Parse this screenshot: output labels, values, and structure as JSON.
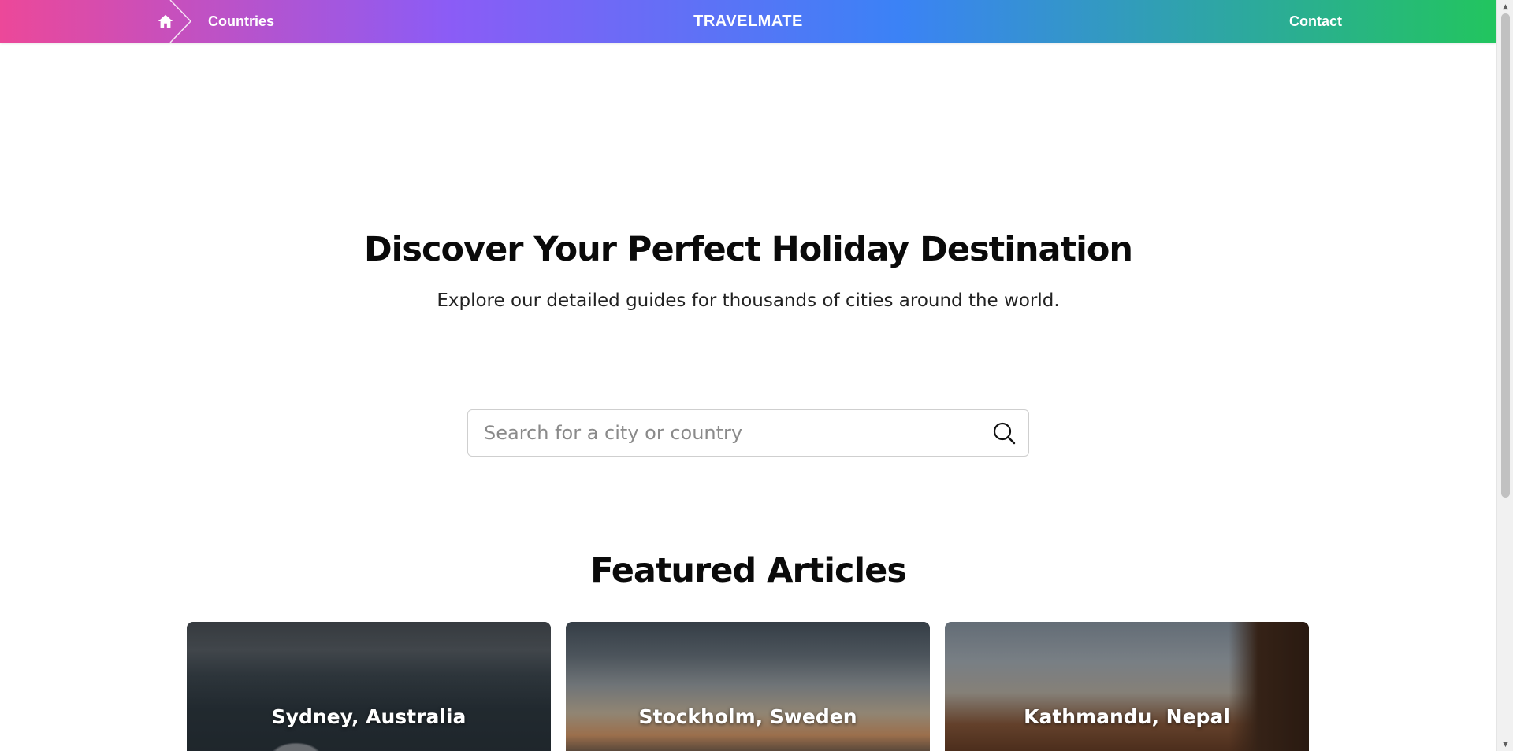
{
  "nav": {
    "home_icon": "home-icon",
    "countries_label": "Countries",
    "brand": "TRAVELMATE",
    "contact_label": "Contact",
    "gradient_colors": [
      "#ec4899",
      "#8b5cf6",
      "#3b82f6",
      "#22c55e"
    ]
  },
  "hero": {
    "title": "Discover Your Perfect Holiday Destination",
    "subtitle": "Explore our detailed guides for thousands of cities around the world."
  },
  "search": {
    "placeholder": "Search for a city or country",
    "value": "",
    "icon": "search-icon"
  },
  "featured": {
    "title": "Featured Articles",
    "cards": [
      {
        "label": "Sydney, Australia"
      },
      {
        "label": "Stockholm, Sweden"
      },
      {
        "label": "Kathmandu, Nepal"
      }
    ]
  }
}
